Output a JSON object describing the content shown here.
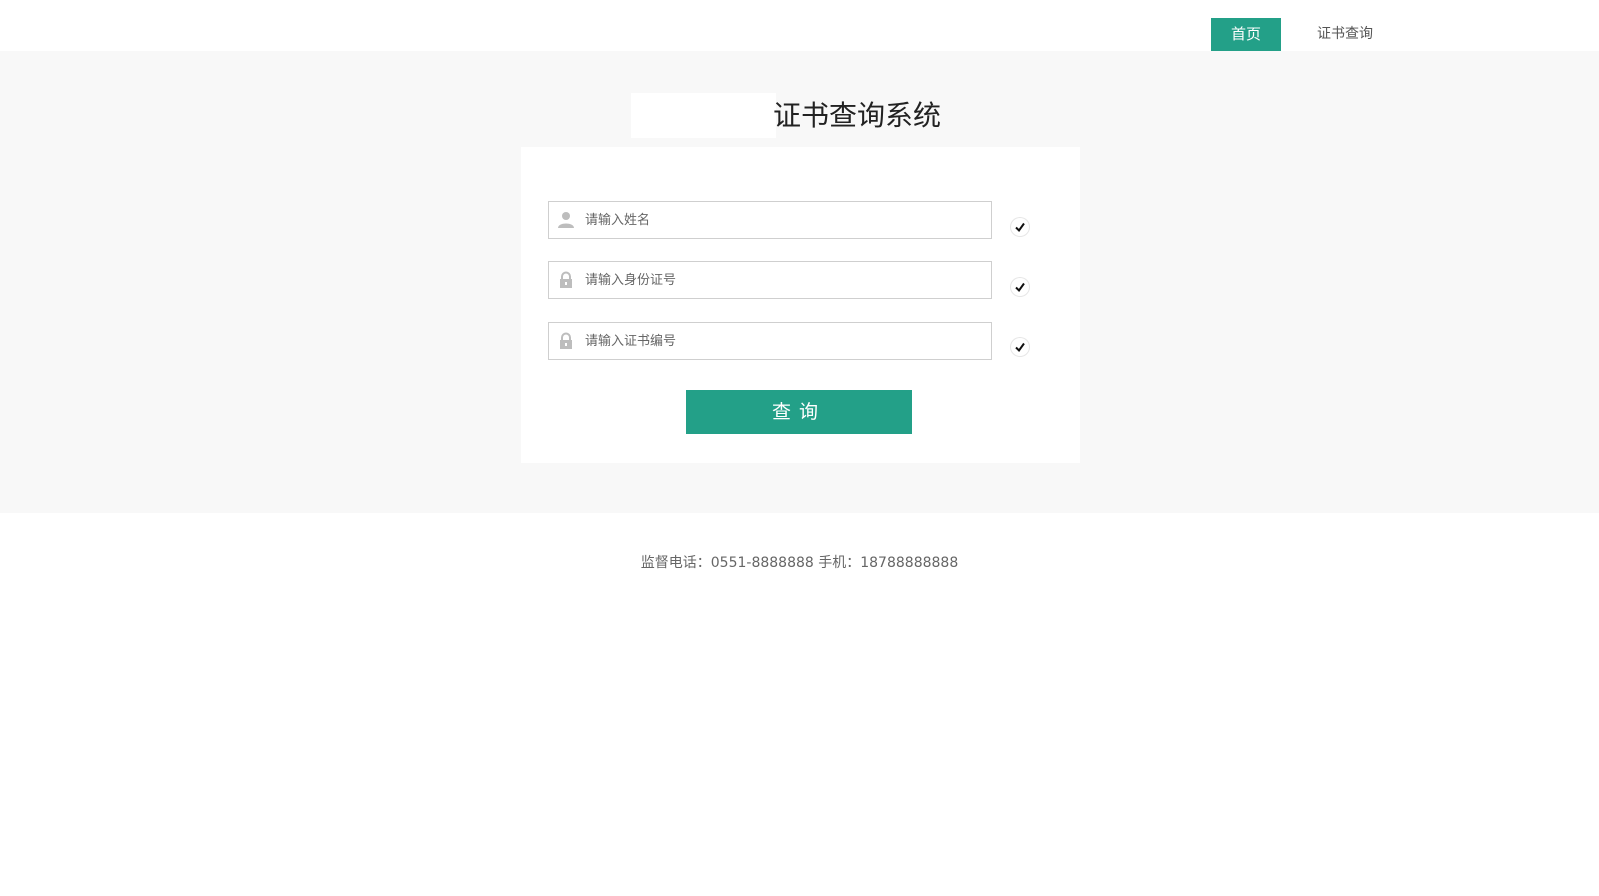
{
  "nav": {
    "home_label": "首页",
    "query_label": "证书查询"
  },
  "header": {
    "title": "证书查询系统"
  },
  "form": {
    "name_placeholder": "请输入姓名",
    "id_placeholder": "请输入身份证号",
    "cert_placeholder": "请输入证书编号",
    "submit_label": "查询"
  },
  "footer": {
    "contact": "监督电话：0551-8888888  手机：18788888888"
  },
  "colors": {
    "accent": "#23a088",
    "band_background": "#f8f8f8"
  },
  "icons": {
    "name_field": "user-icon",
    "id_field": "lock-icon",
    "cert_field": "lock-icon",
    "status": "checkmark-icon"
  }
}
